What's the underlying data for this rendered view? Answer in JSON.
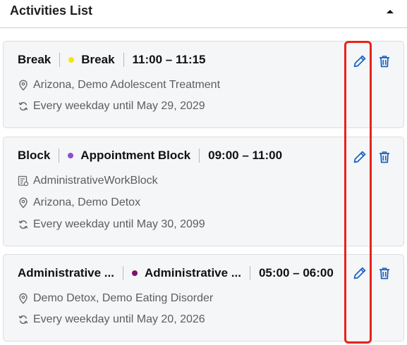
{
  "header": {
    "title": "Activities List"
  },
  "activities": [
    {
      "name": "Break",
      "type": "Break",
      "type_color": "#f7e600",
      "time": "11:00 – 11:15",
      "workblock": null,
      "locations": "Arizona, Demo Adolescent Treatment",
      "recurrence": "Every weekday until May 29, 2029"
    },
    {
      "name": "Block",
      "type": "Appointment Block",
      "type_color": "#8a4fd9",
      "time": "09:00 – 11:00",
      "workblock": "AdministrativeWorkBlock",
      "locations": "Arizona, Demo Detox",
      "recurrence": "Every weekday until May 30, 2099"
    },
    {
      "name": "Administrative ...",
      "type": "Administrative ...",
      "type_color": "#7a1470",
      "time": "05:00 – 06:00",
      "workblock": null,
      "locations": "Demo Detox, Demo Eating Disorder",
      "recurrence": "Every weekday until May 20, 2026"
    }
  ],
  "colors": {
    "action_blue": "#1b63c4",
    "highlight_red": "#e8231a"
  }
}
